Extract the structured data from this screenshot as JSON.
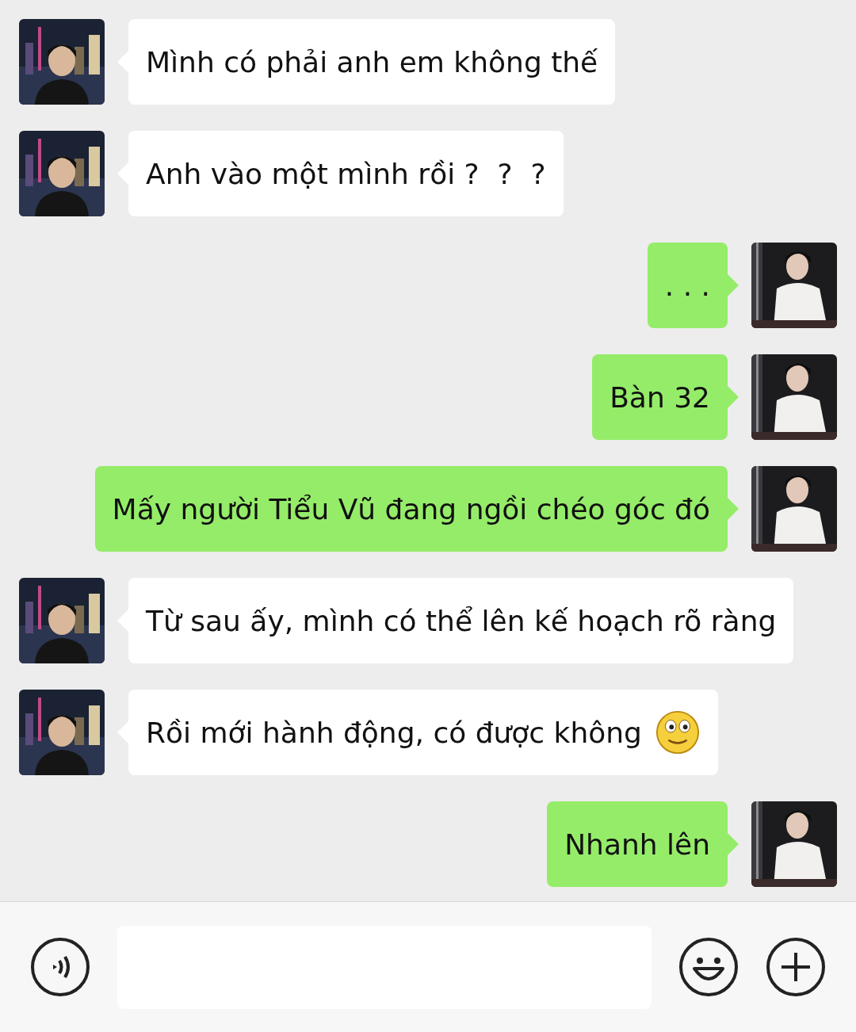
{
  "messages": [
    {
      "kind": "incoming",
      "text": "Mình có phải anh em không thế",
      "emoji": false
    },
    {
      "kind": "incoming",
      "text": "Anh vào một mình rồi ?  ?  ?",
      "emoji": false
    },
    {
      "kind": "outgoing",
      "text": ". . .",
      "emoji": false
    },
    {
      "kind": "outgoing",
      "text": "Bàn 32",
      "emoji": false
    },
    {
      "kind": "outgoing",
      "text": "Mấy người Tiểu Vũ đang ngồi chéo góc đó",
      "emoji": false
    },
    {
      "kind": "incoming",
      "text": "Từ sau ấy, mình có thể lên kế hoạch rõ ràng",
      "emoji": false
    },
    {
      "kind": "incoming",
      "text": "Rồi mới hành động, có được không",
      "emoji": true
    },
    {
      "kind": "outgoing",
      "text": "Nhanh lên",
      "emoji": false
    }
  ],
  "composer": {
    "kind": "text"
  }
}
